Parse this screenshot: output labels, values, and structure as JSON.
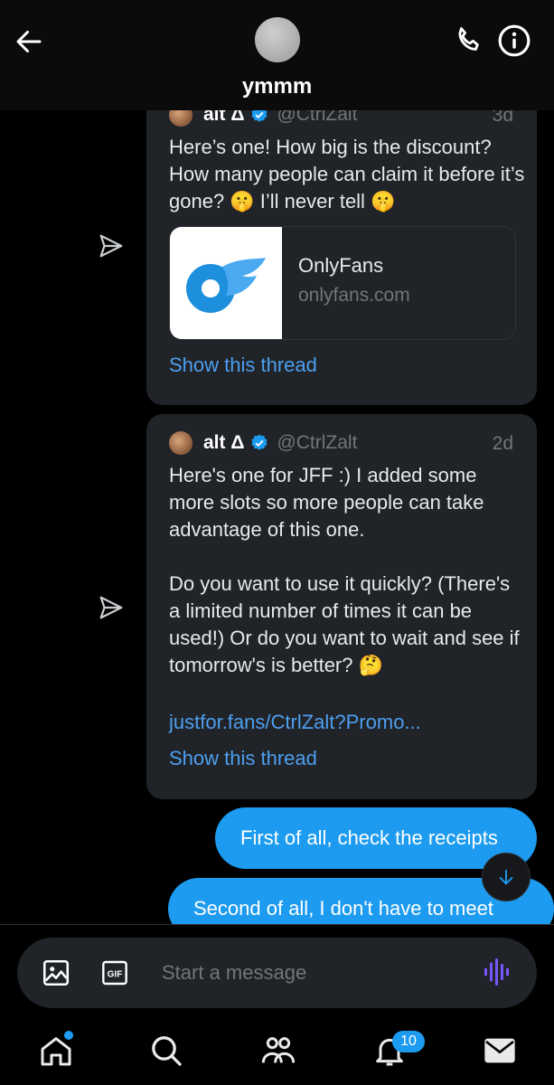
{
  "header": {
    "title": "ymmm"
  },
  "messages": {
    "quote1": {
      "name": "alt Δ",
      "handle": "@CtrlZalt",
      "time": "3d",
      "text": "Here’s one! How big is the discount? How many people can claim it before it’s gone? 🤫 I’ll never tell 🤫",
      "link_card": {
        "title": "OnlyFans",
        "domain": "onlyfans.com"
      },
      "show_thread": "Show this thread"
    },
    "quote2": {
      "name": "alt Δ",
      "handle": "@CtrlZalt",
      "time": "2d",
      "text": "Here's one for JFF :) I added some more slots so more people can take advantage of this one.\n\nDo you want to use it quickly? (There's a limited number of times it can be used!) Or do you want to wait and see if tomorrow's is better? 🤔",
      "link": "justfor.fans/CtrlZalt?Promo...",
      "show_thread": "Show this thread"
    },
    "sent": [
      {
        "text": "First of all, check the receipts"
      },
      {
        "text": "Second of all, I don't have to meet"
      }
    ]
  },
  "composer": {
    "placeholder": "Start a message"
  },
  "nav": {
    "notifications_count": "10"
  },
  "colors": {
    "accent": "#1d9bf0",
    "link": "#4d9ff0",
    "card_bg": "#202327",
    "muted": "#71767b"
  }
}
